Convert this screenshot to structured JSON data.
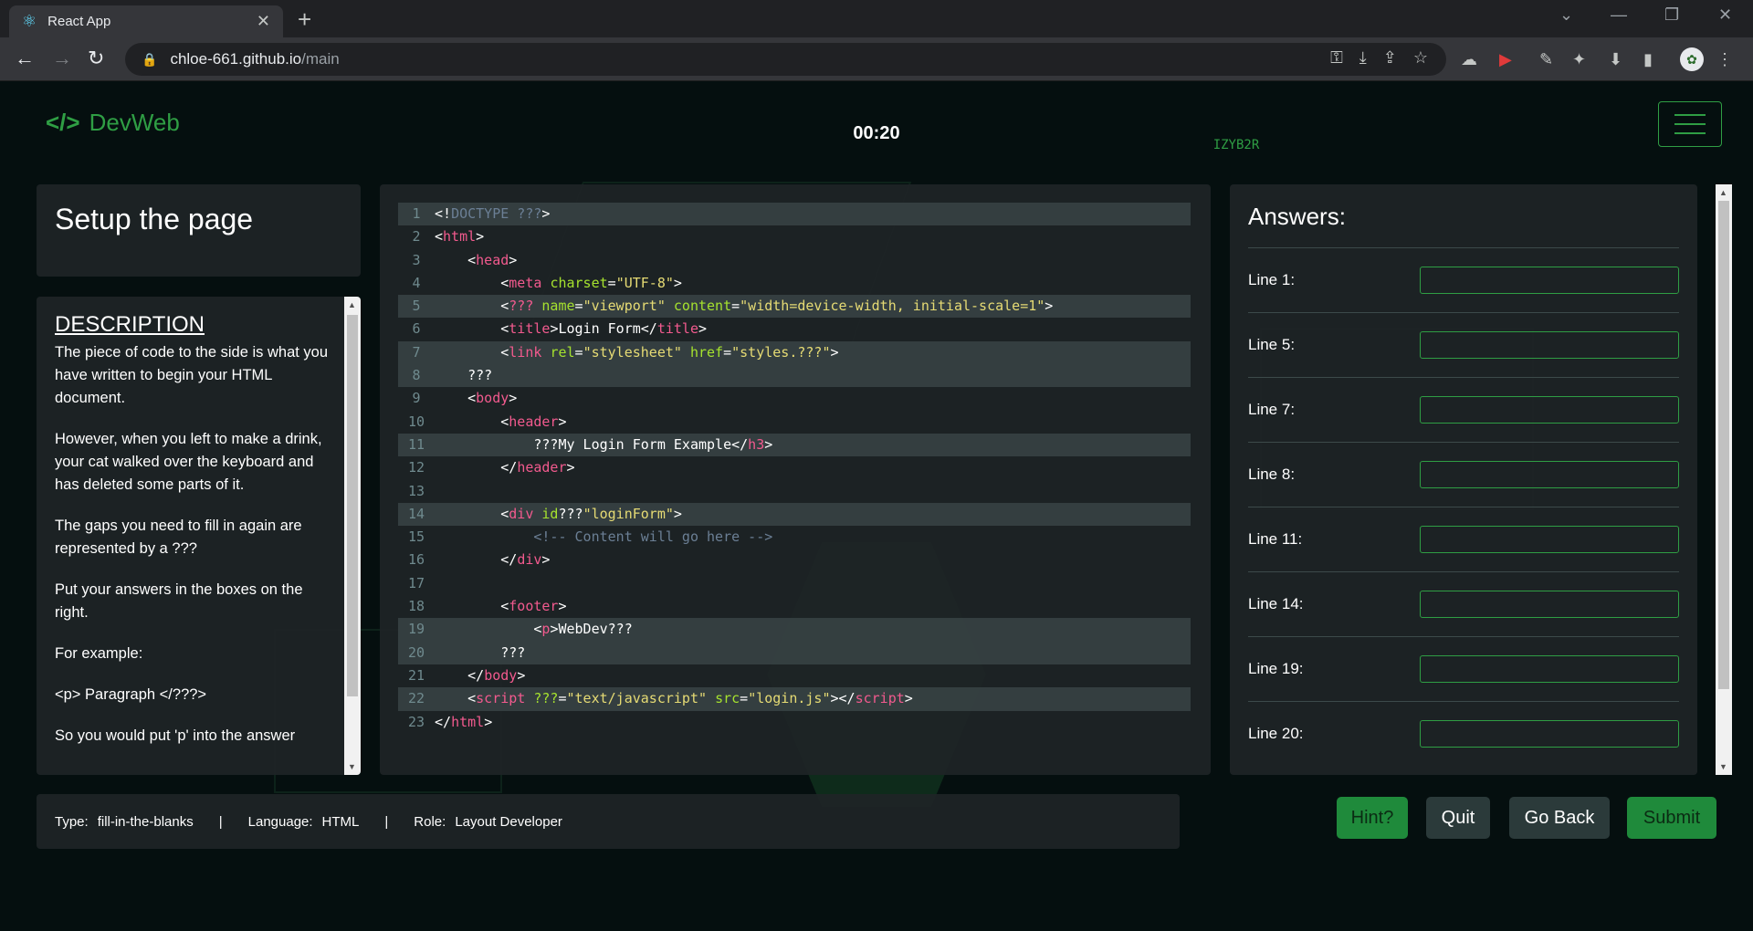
{
  "browser": {
    "tab_title": "React App",
    "url_host": "chloe-661.github.io",
    "url_path": "/main"
  },
  "header": {
    "brand_symbol": "</>",
    "brand_name": "DevWeb",
    "room_code": "IZYB2R",
    "timer": "00:20"
  },
  "task": {
    "title": "Setup the page",
    "description_heading": "DESCRIPTION",
    "paragraphs": [
      "The piece of code to the side is what you have written to begin your HTML document.",
      "However, when you left to make a drink, your cat walked over the keyboard and has deleted some parts of it.",
      "The gaps you need to fill in again are represented by a ???",
      "Put your answers in the boxes on the right.",
      "For example:",
      "<p> Paragraph </???>",
      "So you would put 'p' into the answer"
    ]
  },
  "code_lines": [
    {
      "n": "1",
      "hl": true,
      "seg": [
        [
          "",
          "<!"
        ],
        [
          "doc",
          "DOCTYPE ???"
        ],
        [
          "",
          ">"
        ]
      ]
    },
    {
      "n": "2",
      "hl": false,
      "seg": [
        [
          "",
          "<"
        ],
        [
          "tag",
          "html"
        ],
        [
          "",
          ">"
        ]
      ]
    },
    {
      "n": "3",
      "hl": false,
      "seg": [
        [
          "",
          "    <"
        ],
        [
          "tag",
          "head"
        ],
        [
          "",
          ">"
        ]
      ]
    },
    {
      "n": "4",
      "hl": false,
      "seg": [
        [
          "",
          "        <"
        ],
        [
          "tag",
          "meta"
        ],
        [
          "",
          " "
        ],
        [
          "attr",
          "charset"
        ],
        [
          "",
          "="
        ],
        [
          "str",
          "\"UTF-8\""
        ],
        [
          "",
          ">"
        ]
      ]
    },
    {
      "n": "5",
      "hl": true,
      "seg": [
        [
          "",
          "        <"
        ],
        [
          "tag",
          "???"
        ],
        [
          "",
          " "
        ],
        [
          "attr",
          "name"
        ],
        [
          "",
          "="
        ],
        [
          "str",
          "\"viewport\""
        ],
        [
          "",
          " "
        ],
        [
          "attr",
          "content"
        ],
        [
          "",
          "="
        ],
        [
          "str",
          "\"width=device-width, initial-scale=1\""
        ],
        [
          "",
          ">"
        ]
      ]
    },
    {
      "n": "6",
      "hl": false,
      "seg": [
        [
          "",
          "        <"
        ],
        [
          "tag",
          "title"
        ],
        [
          "",
          ">Login Form</"
        ],
        [
          "tag",
          "title"
        ],
        [
          "",
          ">"
        ]
      ]
    },
    {
      "n": "7",
      "hl": true,
      "seg": [
        [
          "",
          "        <"
        ],
        [
          "tag",
          "link"
        ],
        [
          "",
          " "
        ],
        [
          "attr",
          "rel"
        ],
        [
          "",
          "="
        ],
        [
          "str",
          "\"stylesheet\""
        ],
        [
          "",
          " "
        ],
        [
          "attr",
          "href"
        ],
        [
          "",
          "="
        ],
        [
          "str",
          "\"styles.???\""
        ],
        [
          "",
          ">"
        ]
      ]
    },
    {
      "n": "8",
      "hl": true,
      "seg": [
        [
          "",
          "    ???"
        ]
      ]
    },
    {
      "n": "9",
      "hl": false,
      "seg": [
        [
          "",
          "    <"
        ],
        [
          "tag",
          "body"
        ],
        [
          "",
          ">"
        ]
      ]
    },
    {
      "n": "10",
      "hl": false,
      "seg": [
        [
          "",
          "        <"
        ],
        [
          "tag",
          "header"
        ],
        [
          "",
          ">"
        ]
      ]
    },
    {
      "n": "11",
      "hl": true,
      "seg": [
        [
          "",
          "            ???My Login Form Example</"
        ],
        [
          "tag",
          "h3"
        ],
        [
          "",
          ">"
        ]
      ]
    },
    {
      "n": "12",
      "hl": false,
      "seg": [
        [
          "",
          "        </"
        ],
        [
          "tag",
          "header"
        ],
        [
          "",
          ">"
        ]
      ]
    },
    {
      "n": "13",
      "hl": false,
      "seg": [
        [
          "",
          ""
        ]
      ]
    },
    {
      "n": "14",
      "hl": true,
      "seg": [
        [
          "",
          "        <"
        ],
        [
          "tag",
          "div"
        ],
        [
          "",
          " "
        ],
        [
          "attr",
          "id"
        ],
        [
          "",
          "???"
        ],
        [
          "str",
          "\"loginForm\""
        ],
        [
          "",
          ">"
        ]
      ]
    },
    {
      "n": "15",
      "hl": false,
      "seg": [
        [
          "",
          "            "
        ],
        [
          "cm",
          "<!-- Content will go here -->"
        ]
      ]
    },
    {
      "n": "16",
      "hl": false,
      "seg": [
        [
          "",
          "        </"
        ],
        [
          "tag",
          "div"
        ],
        [
          "",
          ">"
        ]
      ]
    },
    {
      "n": "17",
      "hl": false,
      "seg": [
        [
          "",
          ""
        ]
      ]
    },
    {
      "n": "18",
      "hl": false,
      "seg": [
        [
          "",
          "        <"
        ],
        [
          "tag",
          "footer"
        ],
        [
          "",
          ">"
        ]
      ]
    },
    {
      "n": "19",
      "hl": true,
      "seg": [
        [
          "",
          "            <"
        ],
        [
          "tag",
          "p"
        ],
        [
          "",
          ">WebDev???"
        ]
      ]
    },
    {
      "n": "20",
      "hl": true,
      "seg": [
        [
          "",
          "        ???"
        ]
      ]
    },
    {
      "n": "21",
      "hl": false,
      "seg": [
        [
          "",
          "    </"
        ],
        [
          "tag",
          "body"
        ],
        [
          "",
          ">"
        ]
      ]
    },
    {
      "n": "22",
      "hl": true,
      "seg": [
        [
          "",
          "    <"
        ],
        [
          "tag",
          "script"
        ],
        [
          "",
          " "
        ],
        [
          "attr",
          "???"
        ],
        [
          "",
          "="
        ],
        [
          "str",
          "\"text/javascript\""
        ],
        [
          "",
          " "
        ],
        [
          "attr",
          "src"
        ],
        [
          "",
          "="
        ],
        [
          "str",
          "\"login.js\""
        ],
        [
          "",
          "></"
        ],
        [
          "tag",
          "script"
        ],
        [
          "",
          ">"
        ]
      ]
    },
    {
      "n": "23",
      "hl": false,
      "seg": [
        [
          "",
          "</"
        ],
        [
          "tag",
          "html"
        ],
        [
          "",
          ">"
        ]
      ]
    }
  ],
  "answers": {
    "heading": "Answers:",
    "rows": [
      {
        "label": "Line 1:",
        "value": ""
      },
      {
        "label": "Line 5:",
        "value": ""
      },
      {
        "label": "Line 7:",
        "value": ""
      },
      {
        "label": "Line 8:",
        "value": ""
      },
      {
        "label": "Line 11:",
        "value": ""
      },
      {
        "label": "Line 14:",
        "value": ""
      },
      {
        "label": "Line 19:",
        "value": ""
      },
      {
        "label": "Line 20:",
        "value": ""
      }
    ]
  },
  "meta": {
    "type_label": "Type:",
    "type_value": "fill-in-the-blanks",
    "language_label": "Language:",
    "language_value": "HTML",
    "role_label": "Role:",
    "role_value": "Layout Developer",
    "separator": "|"
  },
  "buttons": {
    "hint": "Hint?",
    "quit": "Quit",
    "back": "Go Back",
    "submit": "Submit"
  },
  "colors": {
    "accent": "#2f9e44",
    "tag": "#f25a8e",
    "attr": "#a6e22e",
    "string": "#e6db74"
  }
}
